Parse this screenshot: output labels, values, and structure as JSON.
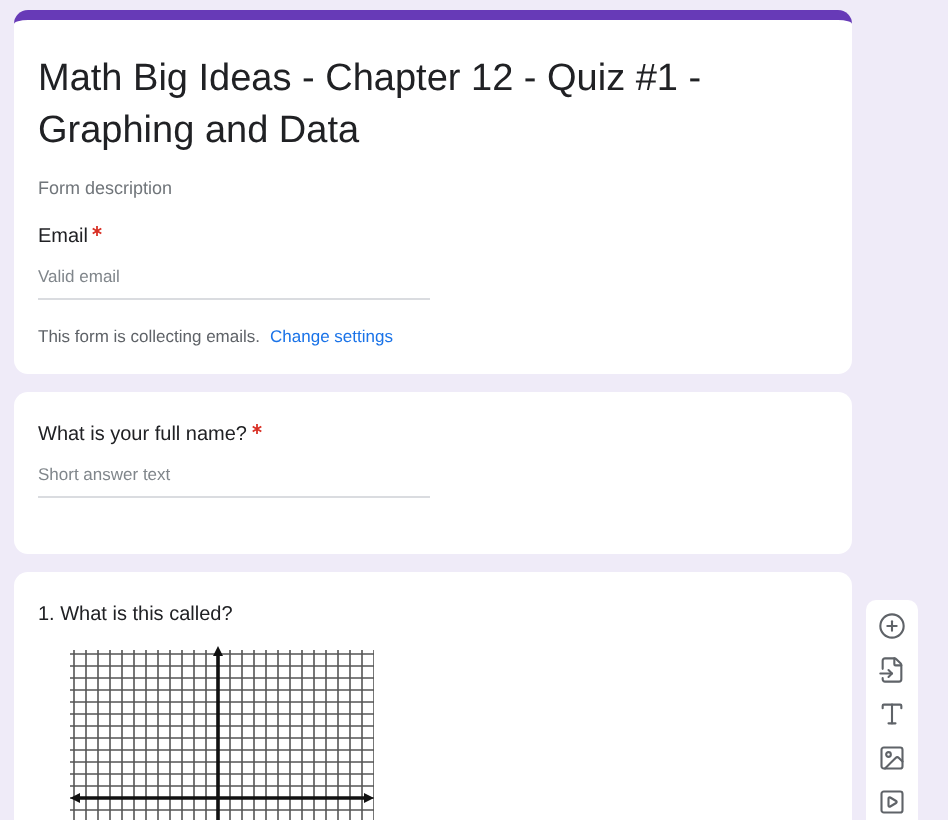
{
  "header": {
    "title": "Math Big Ideas - Chapter 12 - Quiz #1 - Graphing and Data",
    "description": "Form description",
    "email": {
      "label": "Email",
      "required": true,
      "placeholder": "Valid email"
    },
    "note": "This form is collecting emails.",
    "link": "Change settings"
  },
  "questions": [
    {
      "kind": "short",
      "title": "What is your full name?",
      "required": true,
      "placeholder": "Short answer text"
    },
    {
      "kind": "image",
      "title": "1. What is this called?",
      "required": false,
      "picture": {
        "kind": "graph"
      }
    }
  ],
  "toolbar": [
    {
      "kind": "add"
    },
    {
      "kind": "import"
    },
    {
      "kind": "title"
    },
    {
      "kind": "image"
    },
    {
      "kind": "video"
    }
  ]
}
